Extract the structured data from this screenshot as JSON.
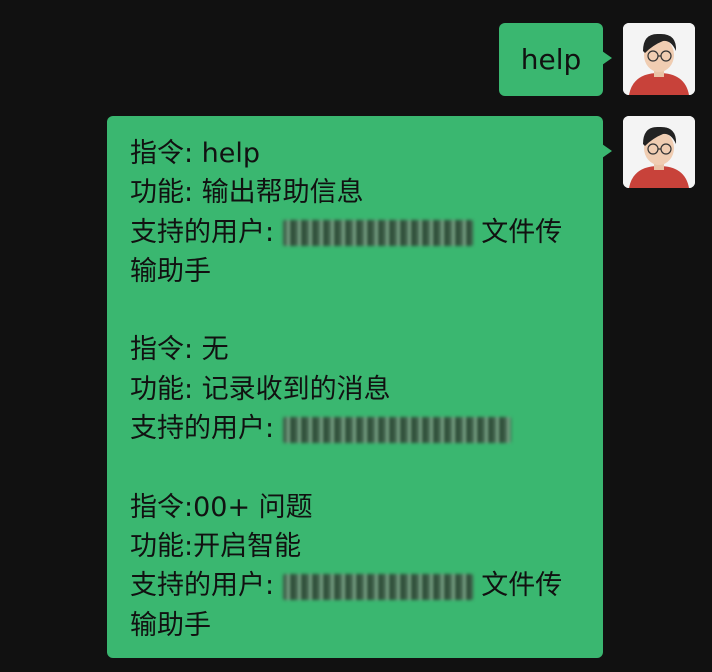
{
  "user_message": {
    "text": "help"
  },
  "bot_reply": {
    "blocks": [
      {
        "cmd_label": "指令: help",
        "func_label": "功能: 输出帮助信息",
        "users_label": "支持的用户:",
        "users_suffix_1": "文件传",
        "users_suffix_2": "输助手"
      },
      {
        "cmd_label": "指令: 无",
        "func_label": "功能: 记录收到的消息",
        "users_label": "支持的用户:"
      },
      {
        "cmd_label": "指令:00+ 问题",
        "func_label": "功能:开启智能",
        "users_label": "支持的用户:",
        "users_suffix_1": "文件传",
        "users_suffix_2": "输助手"
      }
    ]
  },
  "colors": {
    "background": "#111111",
    "bubble": "#3ab770",
    "text": "#111111"
  },
  "icons": [
    "user-avatar-icon",
    "user-avatar-icon"
  ]
}
